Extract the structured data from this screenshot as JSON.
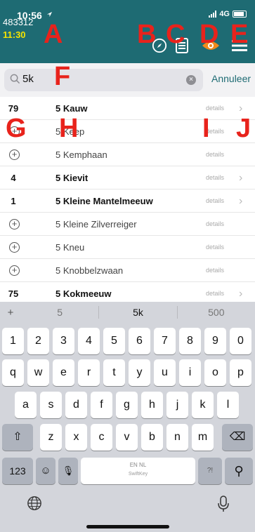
{
  "status_bar": {
    "time": "10:56",
    "network": "4G"
  },
  "header": {
    "obs_count": "483312",
    "obs_time": "11:30"
  },
  "overlay_letters": [
    "A",
    "B",
    "C",
    "D",
    "E",
    "F",
    "G",
    "H",
    "I",
    "J"
  ],
  "icons": {
    "location": "compass-icon",
    "list": "checklist-icon",
    "visibility": "eye-icon",
    "menu": "hamburger-menu-icon",
    "search": "search-icon",
    "clear": "clear-icon",
    "add": "add-circle-icon",
    "chevron": "chevron-right-icon"
  },
  "colors": {
    "header_bg": "#1e6b73",
    "time_accent": "#f5e400",
    "letters": "#e8231c",
    "eye": "#f08a1c"
  },
  "search": {
    "value": "5k",
    "clear_glyph": "×",
    "cancel_label": "Annuleer"
  },
  "list": {
    "details_label": "details",
    "rows": [
      {
        "count": "79",
        "name": "5 Kauw",
        "bold": true,
        "chevron": true
      },
      {
        "count": "",
        "name": "5 Keep",
        "bold": false,
        "chevron": false
      },
      {
        "count": "",
        "name": "5 Kemphaan",
        "bold": false,
        "chevron": false
      },
      {
        "count": "4",
        "name": "5 Kievit",
        "bold": true,
        "chevron": true
      },
      {
        "count": "1",
        "name": "5 Kleine Mantelmeeuw",
        "bold": true,
        "chevron": true
      },
      {
        "count": "",
        "name": "5 Kleine Zilverreiger",
        "bold": false,
        "chevron": false
      },
      {
        "count": "",
        "name": "5 Kneu",
        "bold": false,
        "chevron": false
      },
      {
        "count": "",
        "name": "5 Knobbelzwaan",
        "bold": false,
        "chevron": false
      },
      {
        "count": "75",
        "name": "5 Kokmeeuw",
        "bold": true,
        "chevron": true
      }
    ]
  },
  "keyboard": {
    "suggestions": [
      "+",
      "5",
      "5k",
      "500"
    ],
    "row_numbers": [
      "1",
      "2",
      "3",
      "4",
      "5",
      "6",
      "7",
      "8",
      "9",
      "0"
    ],
    "row_top": [
      "q",
      "w",
      "e",
      "r",
      "t",
      "y",
      "u",
      "i",
      "o",
      "p"
    ],
    "row_middle": [
      "a",
      "s",
      "d",
      "f",
      "g",
      "h",
      "j",
      "k",
      "l"
    ],
    "row_bottom": [
      "z",
      "x",
      "c",
      "v",
      "b",
      "n",
      "m"
    ],
    "shift_glyph": "⇧",
    "backspace_glyph": "⌫",
    "numbers_label": "123",
    "emoji_glyph": "☺",
    "mic_glyph": "🎙",
    "space_languages": "EN NL",
    "space_brand": "SwiftKey",
    "punctuation_glyph": "?!",
    "search_glyph": "⚲",
    "globe_glyph": "🌐",
    "dictation_glyph": "🎙"
  }
}
